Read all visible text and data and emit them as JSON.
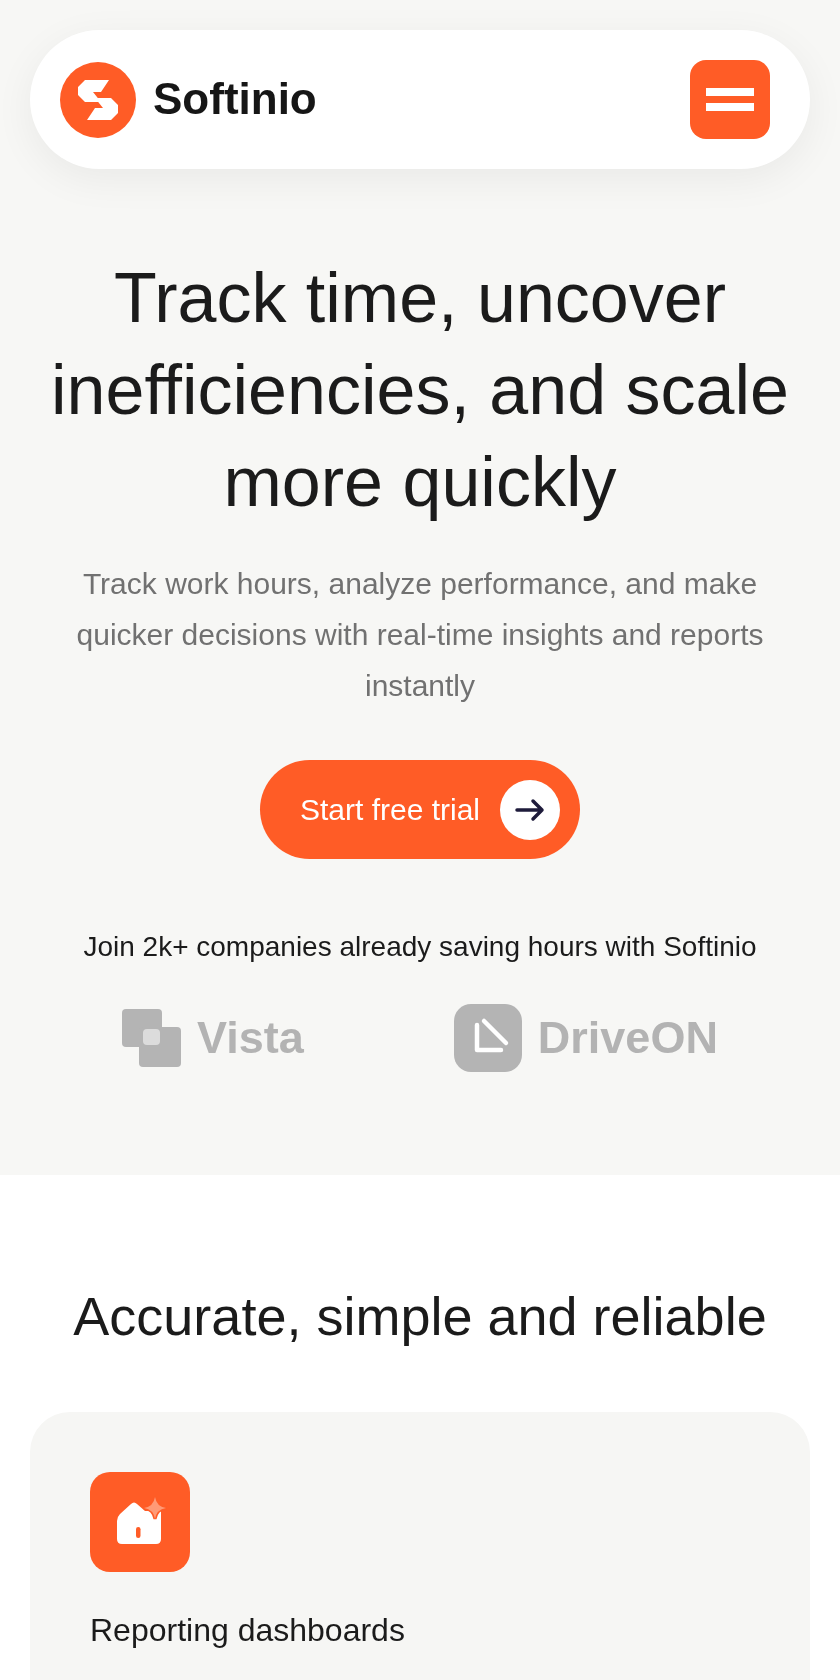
{
  "header": {
    "brand": "Softinio"
  },
  "hero": {
    "title": "Track time, uncover inefficiencies, and scale more quickly",
    "subtitle": "Track work hours, analyze performance, and make quicker decisions with real-time insights and reports instantly",
    "cta": {
      "label": "Start free trial"
    },
    "social_proof": "Join 2k+ companies already saving hours with Softinio",
    "logos": [
      {
        "name": "Vista",
        "kind": "squares"
      },
      {
        "name": "DriveON",
        "kind": "tile"
      }
    ]
  },
  "features": {
    "title": "Accurate, simple and reliable",
    "cards": [
      {
        "title": "Reporting dashboards",
        "kind": "house"
      }
    ]
  }
}
